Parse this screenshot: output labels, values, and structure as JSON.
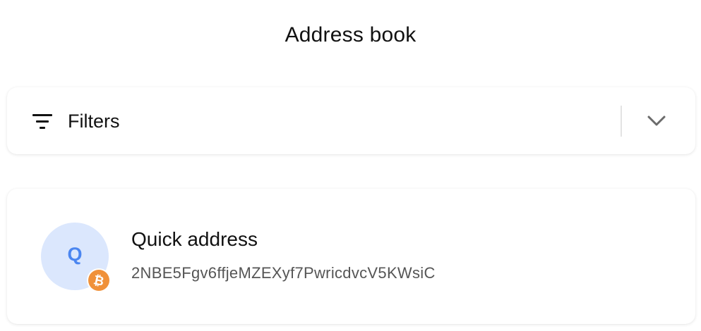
{
  "header": {
    "title": "Address book"
  },
  "filters": {
    "label": "Filters",
    "icon": "filter-lines-icon",
    "toggle_icon": "chevron-down-icon",
    "expanded": false
  },
  "addresses": [
    {
      "name": "Quick address",
      "address": "2NBE5Fgv6ffjeMZEXyf7PwricdvcV5KWsiC",
      "avatar_letter": "Q",
      "currency_icon": "bitcoin-icon",
      "avatar_bg": "#dbe7fd",
      "avatar_fg": "#4b86f0",
      "badge_color": "#f0913a"
    }
  ]
}
